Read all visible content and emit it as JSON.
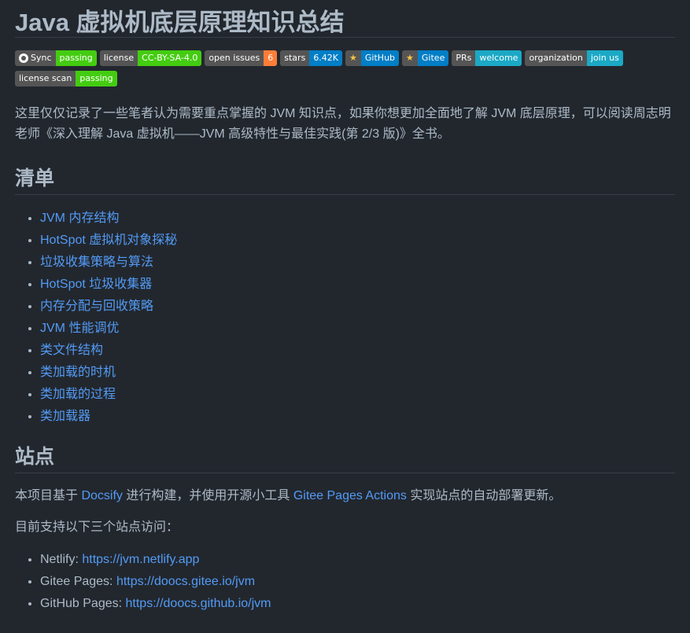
{
  "title": "Java 虚拟机底层原理知识总结",
  "badges": [
    {
      "left": "Sync",
      "right": "passing",
      "color": "#4c1",
      "icon": "github-icon"
    },
    {
      "left": "license",
      "right": "CC-BY-SA-4.0",
      "color": "#4c1"
    },
    {
      "left": "open issues",
      "right": "6",
      "color": "#fe7d37"
    },
    {
      "left": "stars",
      "right": "6.42K",
      "color": "#007ec6"
    },
    {
      "left": "GitHub",
      "right": "",
      "color": "#007ec6",
      "icon": "star-icon"
    },
    {
      "left": "Gitee",
      "right": "",
      "color": "#007ec6",
      "icon": "star-icon"
    },
    {
      "left": "PRs",
      "right": "welcome",
      "color": "#1ba9c5"
    },
    {
      "left": "organization",
      "right": "join us",
      "color": "#1ba9c5"
    },
    {
      "left": "license scan",
      "right": "passing",
      "color": "#4c1"
    }
  ],
  "intro": "这里仅仅记录了一些笔者认为需要重点掌握的 JVM 知识点，如果你想更加全面地了解 JVM 底层原理，可以阅读周志明老师《深入理解 Java 虚拟机——JVM 高级特性与最佳实践(第 2/3 版)》全书。",
  "section_list": {
    "heading": "清单",
    "items": [
      "JVM 内存结构",
      "HotSpot 虚拟机对象探秘",
      "垃圾收集策略与算法",
      "HotSpot 垃圾收集器",
      "内存分配与回收策略",
      "JVM 性能调优",
      "类文件结构",
      "类加载的时机",
      "类加载的过程",
      "类加载器"
    ]
  },
  "section_site": {
    "heading": "站点",
    "p1_a": "本项目基于 ",
    "p1_link1": "Docsify",
    "p1_b": " 进行构建，并使用开源小工具 ",
    "p1_link2": "Gitee Pages Actions",
    "p1_c": " 实现站点的自动部署更新。",
    "p2": "目前支持以下三个站点访问：",
    "sites": [
      {
        "label": "Netlify: ",
        "url": "https://jvm.netlify.app"
      },
      {
        "label": "Gitee Pages: ",
        "url": "https://doocs.gitee.io/jvm"
      },
      {
        "label": "GitHub Pages: ",
        "url": "https://doocs.github.io/jvm"
      }
    ]
  }
}
